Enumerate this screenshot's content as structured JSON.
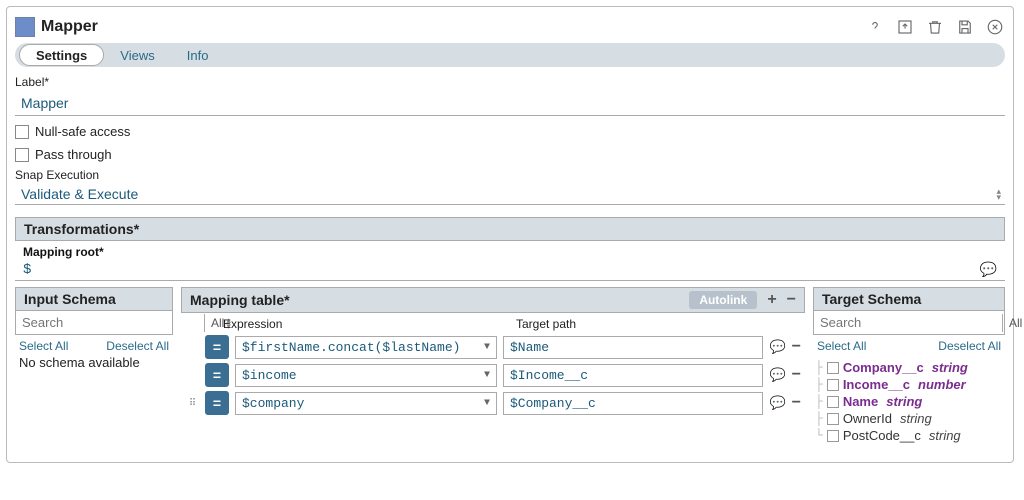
{
  "header": {
    "title": "Mapper",
    "icons": {
      "help": "help-icon",
      "export": "export-icon",
      "trash": "trash-icon",
      "save": "save-icon",
      "close": "close-icon"
    }
  },
  "tabs": [
    {
      "label": "Settings",
      "active": true
    },
    {
      "label": "Views",
      "active": false
    },
    {
      "label": "Info",
      "active": false
    }
  ],
  "label_field": {
    "label": "Label*",
    "value": "Mapper"
  },
  "null_safe": {
    "label": "Null-safe access",
    "checked": false
  },
  "pass_through": {
    "label": "Pass through",
    "checked": false
  },
  "snap_exec": {
    "label": "Snap Execution",
    "value": "Validate & Execute"
  },
  "transformations": {
    "title": "Transformations*",
    "mapping_root": {
      "label": "Mapping root*",
      "value": "$"
    }
  },
  "input_schema": {
    "title": "Input Schema",
    "search_placeholder": "Search",
    "all_label": "All",
    "select_all": "Select All",
    "deselect_all": "Deselect All",
    "empty": "No schema available"
  },
  "mapping_table": {
    "title": "Mapping table*",
    "autolink_label": "Autolink",
    "col_expression": "Expression",
    "col_target": "Target path",
    "rows": [
      {
        "expression": "$firstName.concat($lastName)",
        "target": "$Name"
      },
      {
        "expression": "$income",
        "target": "$Income__c"
      },
      {
        "expression": "$company",
        "target": "$Company__c"
      }
    ]
  },
  "target_schema": {
    "title": "Target Schema",
    "search_placeholder": "Search",
    "all_label": "All",
    "select_all": "Select All",
    "deselect_all": "Deselect All",
    "fields": [
      {
        "name": "Company__c",
        "type": "string",
        "highlight": true
      },
      {
        "name": "Income__c",
        "type": "number",
        "highlight": true
      },
      {
        "name": "Name",
        "type": "string",
        "highlight": true
      },
      {
        "name": "OwnerId",
        "type": "string",
        "highlight": false
      },
      {
        "name": "PostCode__c",
        "type": "string",
        "highlight": false
      }
    ]
  }
}
